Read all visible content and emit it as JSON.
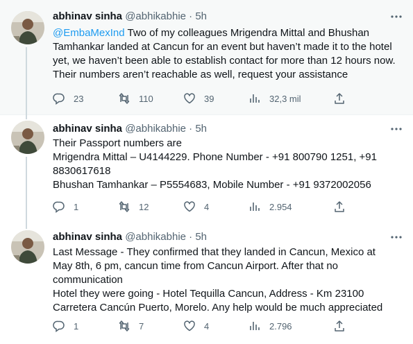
{
  "tweets": [
    {
      "name": "abhinav sinha",
      "handle": "@abhikabhie",
      "dot": "·",
      "time": "5h",
      "mention": "@EmbaMexInd",
      "lines": [
        " Two of my colleagues Mrigendra Mittal and Bhushan Tamhankar landed at Cancun for an event but haven’t made it to the hotel yet, we haven’t been able to establish contact for more than 12 hours now. Their numbers aren’t reachable as well, request your assistance"
      ],
      "replies": "23",
      "retweets": "110",
      "likes": "39",
      "views": "32,3 mil"
    },
    {
      "name": "abhinav sinha",
      "handle": "@abhikabhie",
      "dot": "·",
      "time": "5h",
      "lines": [
        "Their Passport numbers are",
        "Mrigendra Mittal – U4144229. Phone Number - +91 800790 1251, +91 8830617618",
        "Bhushan Tamhankar – P5554683, Mobile Number - +91 9372002056"
      ],
      "replies": "1",
      "retweets": "12",
      "likes": "4",
      "views": "2.954"
    },
    {
      "name": "abhinav sinha",
      "handle": "@abhikabhie",
      "dot": "·",
      "time": "5h",
      "lines": [
        "Last Message - They confirmed that they landed in Cancun, Mexico at May 8th, 6 pm, cancun time from Cancun Airport. After that no communication",
        "Hotel they were going - Hotel Tequilla Cancun, Address - Km 23100 Carretera Cancún Puerto, Morelo. Any help would be much appreciated"
      ],
      "replies": "1",
      "retweets": "7",
      "likes": "4",
      "views": "2.796"
    }
  ],
  "icons": {
    "reply": "reply-icon",
    "retweet": "retweet-icon",
    "like": "heart-icon",
    "views": "views-icon",
    "share": "share-icon",
    "more": "more-icon"
  },
  "colors": {
    "text": "#0f1419",
    "secondary": "#536471",
    "link": "#1d9bf0",
    "thread_line": "#cfd9de",
    "highlight_bg": "#f7f9f9"
  }
}
